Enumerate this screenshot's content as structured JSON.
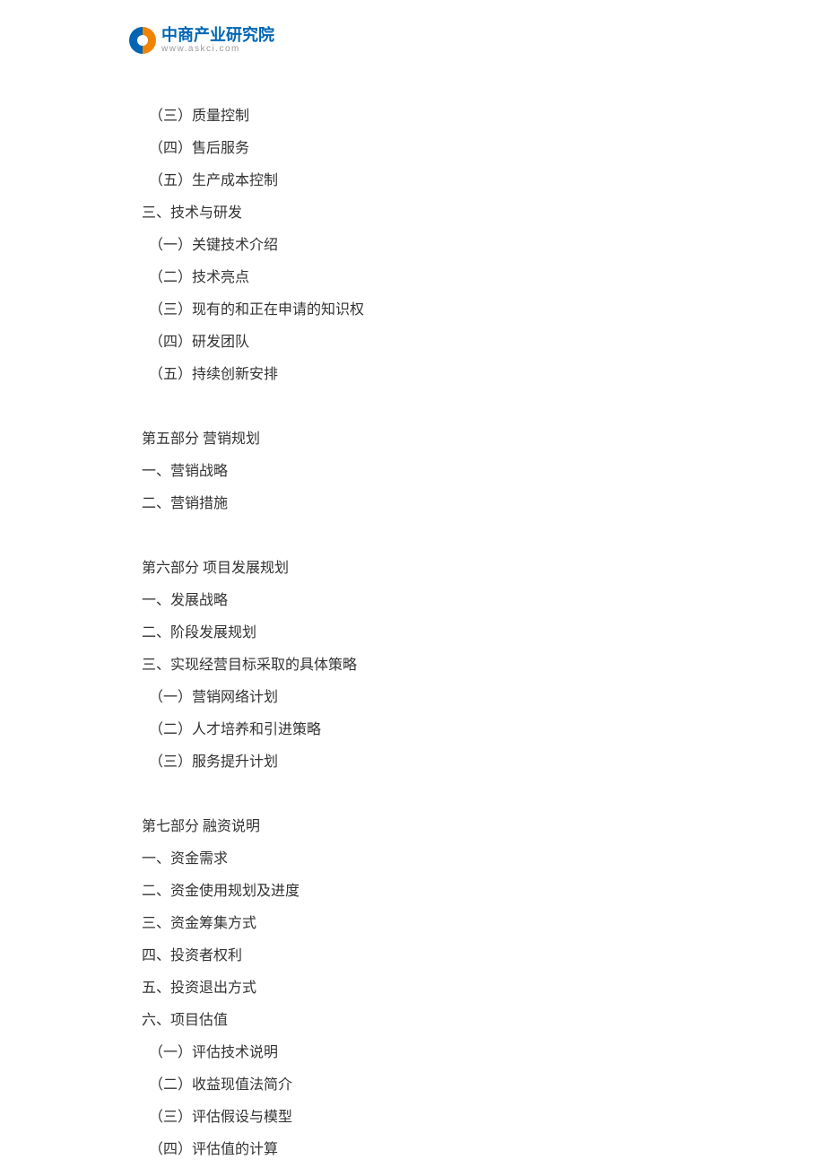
{
  "logo": {
    "title": "中商产业研究院",
    "url": "www.askci.com"
  },
  "lines": [
    {
      "text": "（三）质量控制",
      "cls": "indent"
    },
    {
      "text": "（四）售后服务",
      "cls": "indent"
    },
    {
      "text": "（五）生产成本控制",
      "cls": "indent"
    },
    {
      "text": "三、技术与研发",
      "cls": ""
    },
    {
      "text": "（一）关键技术介绍",
      "cls": "indent"
    },
    {
      "text": "（二）技术亮点",
      "cls": "indent"
    },
    {
      "text": "（三）现有的和正在申请的知识权",
      "cls": "indent"
    },
    {
      "text": "（四）研发团队",
      "cls": "indent"
    },
    {
      "text": "（五）持续创新安排",
      "cls": "indent"
    },
    {
      "text": "第五部分 营销规划",
      "cls": "section-gap"
    },
    {
      "text": "一、营销战略",
      "cls": ""
    },
    {
      "text": "二、营销措施",
      "cls": ""
    },
    {
      "text": "第六部分 项目发展规划",
      "cls": "section-gap"
    },
    {
      "text": "一、发展战略",
      "cls": ""
    },
    {
      "text": "二、阶段发展规划",
      "cls": ""
    },
    {
      "text": "三、实现经营目标采取的具体策略",
      "cls": ""
    },
    {
      "text": "（一）营销网络计划",
      "cls": "indent"
    },
    {
      "text": "（二）人才培养和引进策略",
      "cls": "indent"
    },
    {
      "text": "（三）服务提升计划",
      "cls": "indent"
    },
    {
      "text": "第七部分 融资说明",
      "cls": "section-gap"
    },
    {
      "text": "一、资金需求",
      "cls": ""
    },
    {
      "text": "二、资金使用规划及进度",
      "cls": ""
    },
    {
      "text": "三、资金筹集方式",
      "cls": ""
    },
    {
      "text": "四、投资者权利",
      "cls": ""
    },
    {
      "text": "五、投资退出方式",
      "cls": ""
    },
    {
      "text": "六、项目估值",
      "cls": ""
    },
    {
      "text": "（一）评估技术说明",
      "cls": "indent"
    },
    {
      "text": "（二）收益现值法简介",
      "cls": "indent"
    },
    {
      "text": "（三）评估假设与模型",
      "cls": "indent"
    },
    {
      "text": "（四）评估值的计算",
      "cls": "indent"
    }
  ]
}
